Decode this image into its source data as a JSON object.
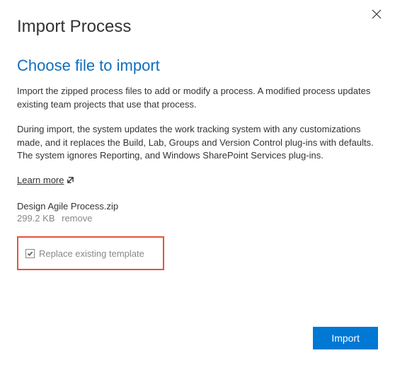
{
  "dialog": {
    "title": "Import Process",
    "section_title": "Choose file to import",
    "paragraph1": "Import the zipped process files to add or modify a process. A modified process updates existing team projects that use that process.",
    "paragraph2": "During import, the system updates the work tracking system with any customizations made, and it replaces the Build, Lab, Groups and Version Control plug-ins with defaults. The system ignores Reporting, and Windows SharePoint Services plug-ins.",
    "learn_more_label": "Learn more"
  },
  "file": {
    "name": "Design Agile Process.zip",
    "size": "299.2 KB",
    "remove_label": "remove"
  },
  "checkbox": {
    "label": "Replace existing template",
    "checked": true
  },
  "footer": {
    "import_label": "Import"
  }
}
